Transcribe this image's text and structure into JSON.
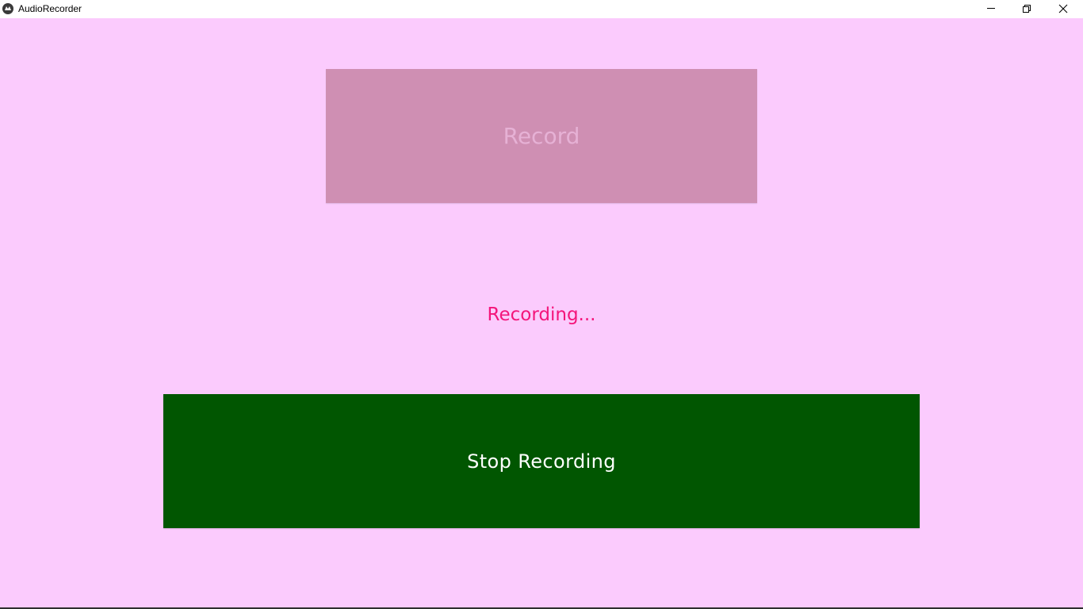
{
  "window": {
    "title": "AudioRecorder",
    "app_icon": "kivy-icon",
    "controls": [
      "minimize-icon",
      "restore-icon",
      "close-icon"
    ]
  },
  "colors": {
    "background": "#fbcbfd",
    "record_button_bg": "#cf8fb3",
    "record_button_text": "#e6b1d5",
    "status_text": "#f4157a",
    "stop_button_bg": "#015601",
    "stop_button_text": "#ffffff"
  },
  "main": {
    "record_button": {
      "label": "Record",
      "state": "disabled"
    },
    "status_label": "Recording...",
    "stop_button": {
      "label": "Stop Recording",
      "state": "enabled"
    }
  }
}
